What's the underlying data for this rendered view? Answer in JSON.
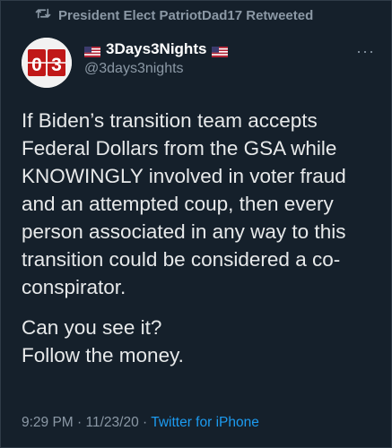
{
  "retweet": {
    "text": "President Elect PatriotDad17 Retweeted"
  },
  "author": {
    "avatar_text": "03",
    "name": "3Days3Nights",
    "handle": "@3days3nights"
  },
  "more_label": "···",
  "tweet": {
    "paragraphs": [
      "If Biden’s transition team accepts Federal Dollars from the GSA while KNOWINGLY involved in voter fraud and an attempted coup, then every person associated in any way to this transition could be considered a co-conspirator.",
      "Can you see it?",
      "Follow the money."
    ]
  },
  "meta": {
    "time": "9:29 PM",
    "separator": "·",
    "date": "11/23/20",
    "source": "Twitter for iPhone"
  },
  "colors": {
    "background": "#15202b",
    "text": "#e7e9ea",
    "muted": "#8b98a5",
    "link": "#1d9bf0"
  }
}
